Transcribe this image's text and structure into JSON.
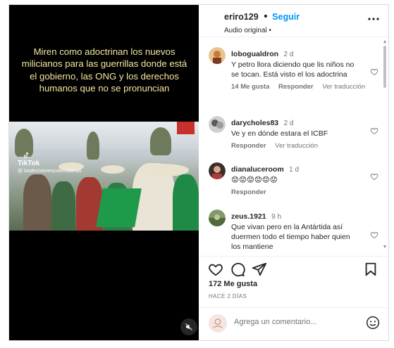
{
  "media": {
    "caption": "Miren como adoctrinan los nuevos milicianos para las guerrillas donde está el gobierno, las ONG  y los derechos humanos que no se pronuncian",
    "watermark_brand": "TikTok",
    "watermark_handle": "@ lasdecisionescolombianas"
  },
  "header": {
    "username": "eriro129",
    "separator": "•",
    "follow_label": "Seguir",
    "audio": "Audio original •"
  },
  "comments": [
    {
      "username": "lobogualdron",
      "time": "2 d",
      "text": "Y petro llora diciendo que lis niños no se tocan. Está visto el los adoctrina",
      "likes": "14 Me gusta",
      "reply": "Responder",
      "translate": "Ver traducción"
    },
    {
      "username": "darycholes83",
      "time": "2 d",
      "text": "Ve y en dónde estara el ICBF",
      "reply": "Responder",
      "translate": "Ver traducción"
    },
    {
      "username": "dianaluceroom",
      "time": "1 d",
      "text": "😟😟😟😟😟😟",
      "reply": "Responder"
    },
    {
      "username": "zeus.1921",
      "time": "9 h",
      "text": "Que vivan pero en la Antártida así duermen todo el tiempo haber quien los mantiene"
    }
  ],
  "post": {
    "likes": "172 Me gusta",
    "when": "HACE 2 DÍAS"
  },
  "add_comment": {
    "placeholder": "Agrega un comentario..."
  },
  "colors": {
    "accent": "#0095f6",
    "text": "#262626",
    "muted": "#737373",
    "caption": "#f4e7a1"
  }
}
